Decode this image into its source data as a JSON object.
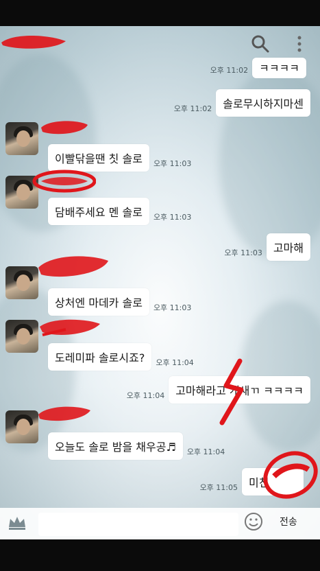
{
  "messages": [
    {
      "side": "right",
      "text": "ㅋㅋㅋㅋ",
      "time": "오후 11:02"
    },
    {
      "side": "right",
      "text": "솔로무시하지마센",
      "time": "오후 11:02"
    },
    {
      "side": "left",
      "text": "이빨닦을땐 칫 솔로",
      "time": "오후 11:03"
    },
    {
      "side": "left",
      "text": "담배주세요 멘 솔로",
      "time": "오후 11:03"
    },
    {
      "side": "right",
      "text": "고마해",
      "time": "오후 11:03"
    },
    {
      "side": "left",
      "text": "상처엔 마데카 솔로",
      "time": "오후 11:03"
    },
    {
      "side": "left",
      "text": "도레미파 솔로시죠?",
      "time": "오후 11:04"
    },
    {
      "side": "right",
      "text": "고마해라고 개새ㄲ ㅋㅋㅋㅋ",
      "time": "오후 11:04"
    },
    {
      "side": "left",
      "text": "오늘도 솔로 밤을 채우공♬",
      "time": "오후 11:04"
    },
    {
      "side": "right",
      "text": "미친",
      "time": "오후 11:05"
    }
  ],
  "composer": {
    "send_label": "전송",
    "placeholder": ""
  },
  "icons": {
    "search": "search-icon",
    "more": "more-vertical-icon",
    "emoji": "emoji-icon",
    "attach": "crown-icon"
  },
  "colors": {
    "redact": "#e0161b",
    "bubble": "#ffffff"
  }
}
